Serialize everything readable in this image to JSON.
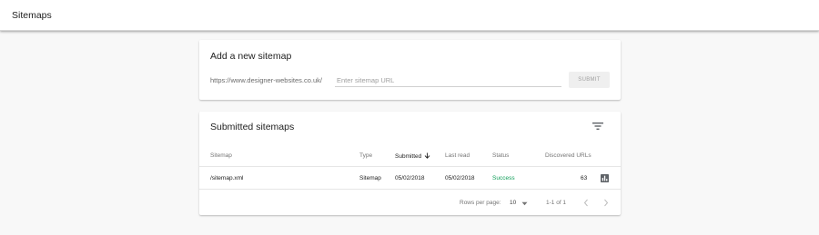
{
  "header": {
    "title": "Sitemaps"
  },
  "add_card": {
    "title": "Add a new sitemap",
    "url_prefix": "https://www.designer-websites.co.uk/",
    "input_placeholder": "Enter sitemap URL",
    "input_value": "",
    "submit_label": "SUBMIT"
  },
  "list_card": {
    "title": "Submitted sitemaps",
    "filter_icon": "filter-list-icon",
    "columns": {
      "sitemap": "Sitemap",
      "type": "Type",
      "submitted": "Submitted",
      "last_read": "Last read",
      "status": "Status",
      "discovered": "Discovered URLs"
    },
    "sort": {
      "column": "submitted",
      "direction": "descending"
    },
    "rows": [
      {
        "sitemap": "/sitemap.xml",
        "type": "Sitemap",
        "submitted": "05/02/2018",
        "last_read": "05/02/2018",
        "status": "Success",
        "discovered": "63",
        "action_icon": "bar-chart-icon"
      }
    ],
    "footer": {
      "rows_per_page_label": "Rows per page:",
      "rows_per_page_value": "10",
      "range_label": "1-1 of 1",
      "prev_icon": "chevron-left-icon",
      "next_icon": "chevron-right-icon"
    }
  },
  "colors": {
    "page_bg": "#f8f8f8",
    "card_bg": "#ffffff",
    "success": "#0f9d58",
    "muted_text": "#757575"
  }
}
